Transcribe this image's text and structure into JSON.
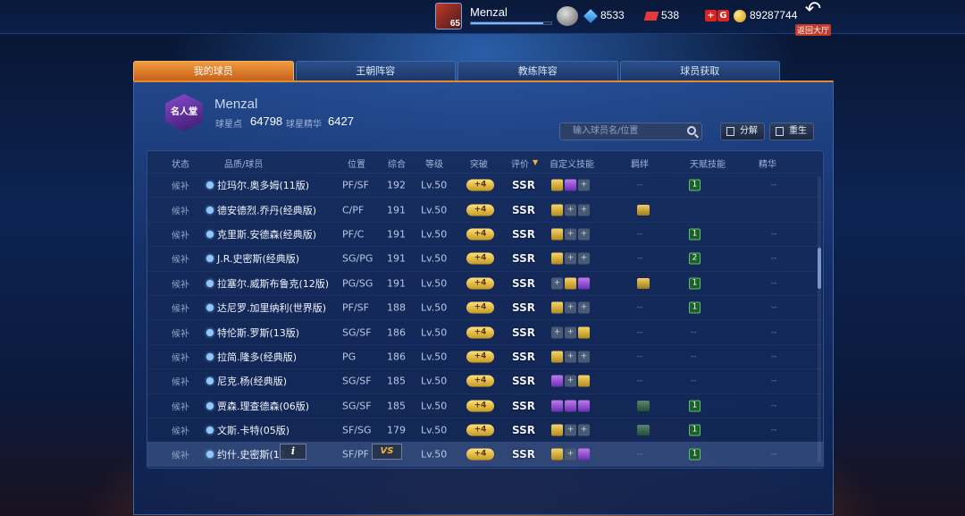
{
  "topbar": {
    "player_name": "Menzal",
    "level": "65",
    "xp_fraction": 0.9,
    "diamonds": "8533",
    "tickets": "538",
    "coins": "89287744",
    "back_label": "返回大厅"
  },
  "tabs": [
    {
      "label": "我的球员",
      "active": true
    },
    {
      "label": "王朝阵容",
      "active": false
    },
    {
      "label": "教练阵容",
      "active": false
    },
    {
      "label": "球员获取",
      "active": false
    }
  ],
  "profile": {
    "badge_text": "名人堂",
    "name": "Menzal",
    "star_points_label": "球星点",
    "star_points": "64798",
    "essence_label": "球星精华",
    "essence": "6427"
  },
  "search": {
    "placeholder": "输入球员名/位置"
  },
  "buttons": {
    "decompose": "分解",
    "rebirth": "重生"
  },
  "table": {
    "headers": {
      "status": "状态",
      "quality": "品质/球员",
      "position": "位置",
      "overall": "综合",
      "level": "等级",
      "breakthrough": "突破",
      "rating": "评价",
      "sort_icon": "▼",
      "skills": "自定义技能",
      "bond": "羁绊",
      "talent": "天赋技能",
      "essence": "精华"
    },
    "rows": [
      {
        "status": "候补",
        "name": "拉玛尔.奥多姆(11版)",
        "pos": "PF/SF",
        "ovr": "192",
        "lv": "Lv.50",
        "brk": "+4",
        "rating": "SSR",
        "skills": [
          "gold",
          "purple",
          "empty"
        ],
        "bond": "--",
        "talent": "1",
        "essence": "--"
      },
      {
        "status": "候补",
        "name": "德安德烈.乔丹(经典版)",
        "pos": "C/PF",
        "ovr": "191",
        "lv": "Lv.50",
        "brk": "+4",
        "rating": "SSR",
        "skills": [
          "gold",
          "empty",
          "empty"
        ],
        "bond": "gold",
        "talent": "",
        "essence": ""
      },
      {
        "status": "候补",
        "name": "克里斯.安德森(经典版)",
        "pos": "PF/C",
        "ovr": "191",
        "lv": "Lv.50",
        "brk": "+4",
        "rating": "SSR",
        "skills": [
          "gold",
          "empty",
          "empty"
        ],
        "bond": "--",
        "talent": "1",
        "essence": "--"
      },
      {
        "status": "候补",
        "name": "J.R.史密斯(经典版)",
        "pos": "SG/PG",
        "ovr": "191",
        "lv": "Lv.50",
        "brk": "+4",
        "rating": "SSR",
        "skills": [
          "gold",
          "empty",
          "empty"
        ],
        "bond": "--",
        "talent": "2",
        "essence": "--"
      },
      {
        "status": "候补",
        "name": "拉塞尔.威斯布鲁克(12版)",
        "pos": "PG/SG",
        "ovr": "191",
        "lv": "Lv.50",
        "brk": "+4",
        "rating": "SSR",
        "skills": [
          "empty",
          "gold",
          "purple"
        ],
        "bond": "gold",
        "talent": "1",
        "essence": "--"
      },
      {
        "status": "候补",
        "name": "达尼罗.加里纳利(世界版)",
        "pos": "PF/SF",
        "ovr": "188",
        "lv": "Lv.50",
        "brk": "+4",
        "rating": "SSR",
        "skills": [
          "gold",
          "empty",
          "empty"
        ],
        "bond": "--",
        "talent": "1",
        "essence": "--"
      },
      {
        "status": "候补",
        "name": "特伦斯.罗斯(13版)",
        "pos": "SG/SF",
        "ovr": "186",
        "lv": "Lv.50",
        "brk": "+4",
        "rating": "SSR",
        "skills": [
          "empty",
          "empty",
          "gold"
        ],
        "bond": "--",
        "talent": "--",
        "essence": "--"
      },
      {
        "status": "候补",
        "name": "拉简.隆多(经典版)",
        "pos": "PG",
        "ovr": "186",
        "lv": "Lv.50",
        "brk": "+4",
        "rating": "SSR",
        "skills": [
          "gold",
          "empty",
          "empty"
        ],
        "bond": "--",
        "talent": "--",
        "essence": "--"
      },
      {
        "status": "候补",
        "name": "尼克.杨(经典版)",
        "pos": "SG/SF",
        "ovr": "185",
        "lv": "Lv.50",
        "brk": "+4",
        "rating": "SSR",
        "skills": [
          "purple",
          "empty",
          "gold"
        ],
        "bond": "--",
        "talent": "--",
        "essence": "--"
      },
      {
        "status": "候补",
        "name": "贾森.理查德森(06版)",
        "pos": "SG/SF",
        "ovr": "185",
        "lv": "Lv.50",
        "brk": "+4",
        "rating": "SSR",
        "skills": [
          "purple",
          "purple",
          "purple"
        ],
        "bond": "green",
        "talent": "1",
        "essence": "--"
      },
      {
        "status": "候补",
        "name": "文斯.卡特(05版)",
        "pos": "SF/SG",
        "ovr": "179",
        "lv": "Lv.50",
        "brk": "+4",
        "rating": "SSR",
        "skills": [
          "gold",
          "empty",
          "empty"
        ],
        "bond": "green",
        "talent": "1",
        "essence": "--"
      },
      {
        "status": "候补",
        "name": "约什.史密斯(12",
        "pos": "SF/PF",
        "ovr": "",
        "lv": "Lv.50",
        "brk": "+4",
        "rating": "SSR",
        "skills": [
          "gold",
          "empty",
          "purple"
        ],
        "bond": "--",
        "talent": "1",
        "essence": "--",
        "selected": true
      }
    ]
  },
  "popups": {
    "info": "i",
    "compare": "VS"
  },
  "colors": {
    "tab_active": "#e38a33",
    "accent_blue": "#2b4f8c"
  }
}
